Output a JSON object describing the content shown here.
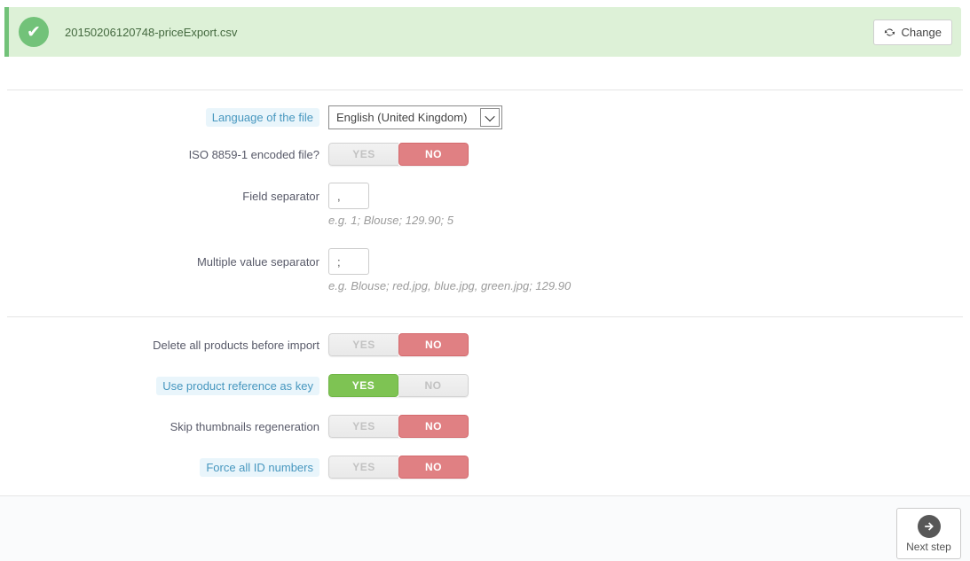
{
  "banner": {
    "filename": "20150206120748-priceExport.csv",
    "change_button": "Change"
  },
  "form": {
    "language": {
      "label": "Language of the file",
      "selected_option": "English (United Kingdom)"
    },
    "iso_encoding": {
      "label": "ISO 8859-1 encoded file?",
      "yes": "YES",
      "no": "NO",
      "value": "NO"
    },
    "field_separator": {
      "label": "Field separator",
      "value": ",",
      "hint": "e.g. 1; Blouse; 129.90; 5"
    },
    "multiple_value_separator": {
      "label": "Multiple value separator",
      "value": ";",
      "hint": "e.g. Blouse; red.jpg, blue.jpg, green.jpg; 129.90"
    },
    "delete_all_products": {
      "label": "Delete all products before import",
      "yes": "YES",
      "no": "NO",
      "value": "NO"
    },
    "use_product_reference": {
      "label": "Use product reference as key",
      "yes": "YES",
      "no": "NO",
      "value": "YES"
    },
    "skip_thumbnails": {
      "label": "Skip thumbnails regeneration",
      "yes": "YES",
      "no": "NO",
      "value": "NO"
    },
    "force_ids": {
      "label": "Force all ID numbers",
      "yes": "YES",
      "no": "NO",
      "value": "NO"
    }
  },
  "footer": {
    "next_step": "Next step"
  },
  "colors": {
    "success_bg": "#ddf1d7",
    "success_accent": "#72c279",
    "toggle_yes_active": "#7ec353",
    "toggle_no_active": "#e08083",
    "link_label": "#4797bf",
    "footer_bg": "#fafbfc"
  }
}
